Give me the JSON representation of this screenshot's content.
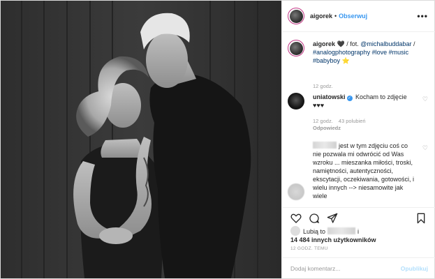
{
  "header": {
    "username": "aigorek",
    "dot": "•",
    "follow_label": "Obserwuj",
    "more_icon": "ellipsis-icon"
  },
  "caption": {
    "username": "aigorek",
    "heart": "🖤",
    "text": " / fot. ",
    "mention1": "@michalbuddabar",
    "slash": " /",
    "hashtags": "#analogphotography #love #music #babyboy",
    "star": "⭐",
    "time": "12 godz."
  },
  "comments": [
    {
      "username": "uniatowski",
      "text": "Kocham to zdjęcie ♥♥♥",
      "time": "12 godz.",
      "likes": "43 polubień",
      "reply": "Odpowiedz",
      "verified": true
    },
    {
      "username": "",
      "text": "jest w tym zdjęciu coś co nie pozwala mi odwrócić od Was wzroku ... mieszanka miłości, troski, namiętności, autentyczności, ekscytacji, oczekiwania, gotowości, i wielu innych --> niesamowite jak wiele"
    }
  ],
  "actions": {
    "like": "heart-icon",
    "comment": "comment-icon",
    "share": "share-icon",
    "save": "bookmark-icon"
  },
  "likes": {
    "prefix": "Lubią to",
    "suffix": "i",
    "count_text": "14 484 innych użytkowników"
  },
  "timestamp": "12 GODZ. TEMU",
  "add_comment": {
    "placeholder": "Dodaj komentarz...",
    "publish": "Opublikuj"
  },
  "colors": {
    "link_blue": "#3897f0",
    "hashtag": "#003569",
    "muted": "#999999",
    "publish_disabled": "#b2dffc"
  }
}
